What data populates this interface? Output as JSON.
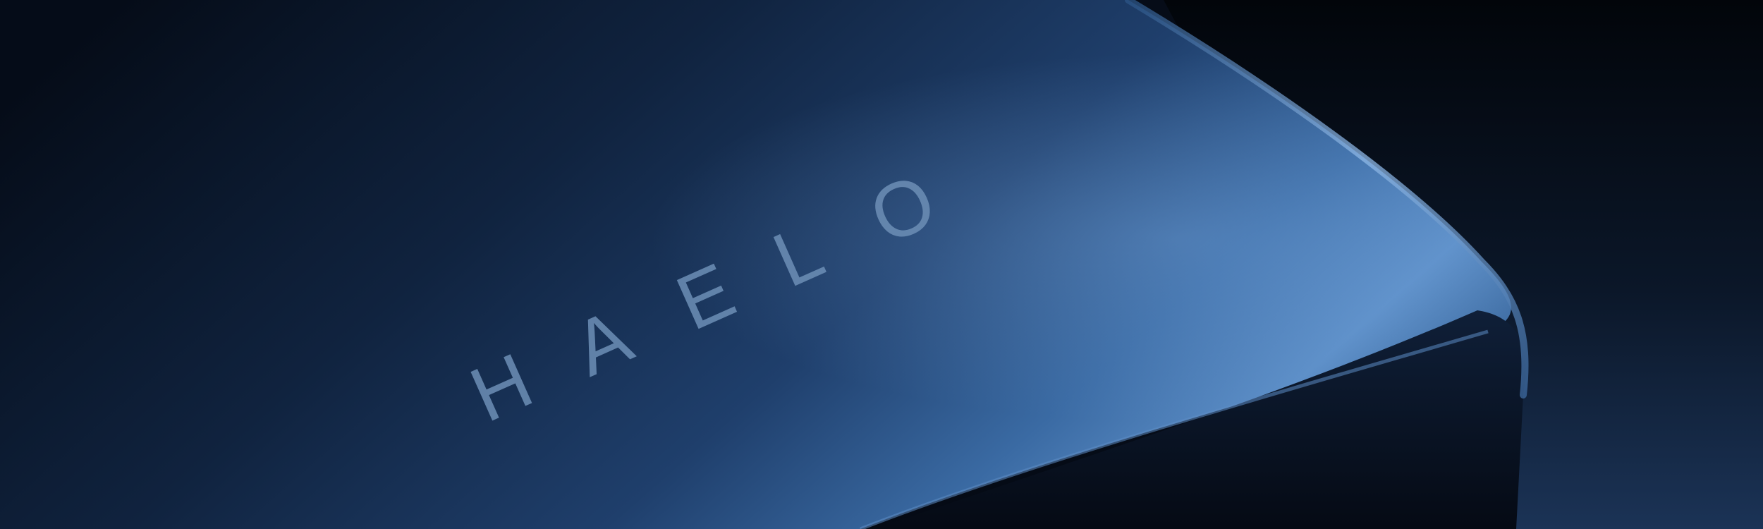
{
  "product": {
    "brand_letters": [
      "H",
      "A",
      "E",
      "L",
      "O"
    ]
  },
  "colors": {
    "background_dark": "#03070d",
    "surface_dark": "#0c1a33",
    "surface_mid": "#1c3a66",
    "surface_highlight": "#5d8fc8",
    "edge_highlight": "#8fb8e6",
    "front_face": "#0a1426",
    "logo_tint": "#6d8fb6"
  }
}
